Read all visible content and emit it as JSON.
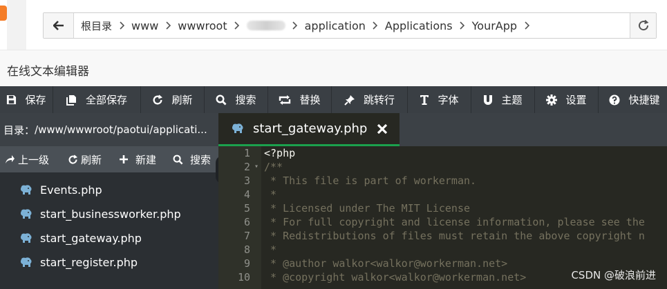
{
  "breadcrumb": {
    "items": [
      "根目录",
      "www",
      "wwwroot",
      "",
      "application",
      "Applications",
      "YourApp"
    ]
  },
  "editor_title": "在线文本编辑器",
  "toolbar": [
    {
      "label": "保存",
      "icon": "save-icon",
      "width": 77
    },
    {
      "label": "全部保存",
      "icon": "save-all-icon",
      "width": 127
    },
    {
      "label": "刷新",
      "icon": "refresh-icon",
      "width": 92
    },
    {
      "label": "搜索",
      "icon": "search-icon",
      "width": 92
    },
    {
      "label": "替换",
      "icon": "replace-icon",
      "width": 92
    },
    {
      "label": "跳转行",
      "icon": "pin-icon",
      "width": 110
    },
    {
      "label": "字体",
      "icon": "font-icon",
      "width": 92
    },
    {
      "label": "主题",
      "icon": "magnet-icon",
      "width": 92
    },
    {
      "label": "设置",
      "icon": "gear-icon",
      "width": 92
    },
    {
      "label": "快捷键",
      "icon": "help-icon",
      "width": 105
    }
  ],
  "sidebar": {
    "dir_label": "目录：",
    "dir_path": "/www/wwwroot/paotui/applicati...",
    "actions": [
      {
        "label": "上一级",
        "icon": "share-icon"
      },
      {
        "label": "刷新",
        "icon": "refresh-icon"
      },
      {
        "label": "新建",
        "icon": "plus-icon"
      },
      {
        "label": "搜索",
        "icon": "search-icon"
      }
    ],
    "files": [
      "Events.php",
      "start_businessworker.php",
      "start_gateway.php",
      "start_register.php"
    ]
  },
  "tab": {
    "label": "start_gateway.php"
  },
  "code": {
    "line_numbers": [
      "1",
      "2",
      "3",
      "4",
      "5",
      "6",
      "7",
      "8",
      "9",
      "10"
    ],
    "lines": [
      "<?php",
      "/**",
      " * This file is part of workerman.",
      " *",
      " * Licensed under The MIT License",
      " * For full copyright and license information, please see the",
      " * Redistributions of files must retain the above copyright n",
      " *",
      " * @author walkor<walkor@workerman.net>",
      " * @copyright walkor<walkor@workerman.net>"
    ]
  },
  "watermark": "CSDN @破浪前进",
  "colors": {
    "toolbar_bg": "#3a3f44",
    "editor_bg": "#272822",
    "tab_accent": "#1ba14d",
    "comment": "#75715e"
  }
}
